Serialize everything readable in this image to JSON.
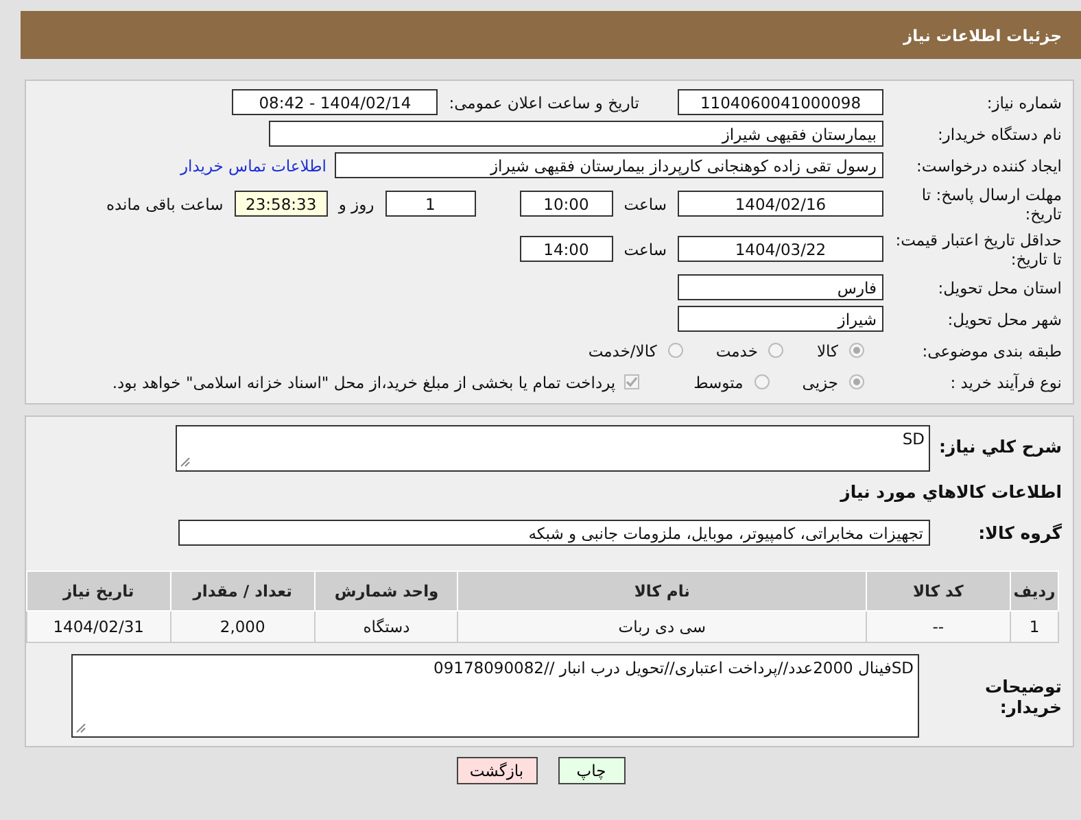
{
  "header": {
    "title": "جزئیات اطلاعات نیاز"
  },
  "details": {
    "need_number": {
      "label": "شماره نیاز:",
      "value": "1104060041000098"
    },
    "announce": {
      "label": "تاریخ و ساعت اعلان عمومی:",
      "value": "1404/02/14 - 08:42"
    },
    "buyer_org": {
      "label": "نام دستگاه خریدار:",
      "value": "بیمارستان فقیهی شیراز"
    },
    "requester": {
      "label": "ایجاد کننده درخواست:",
      "value": "رسول تقی زاده کوهنجانی کارپرداز بیمارستان فقیهی شیراز",
      "link": "اطلاعات تماس خریدار"
    },
    "deadline": {
      "label": "مهلت ارسال پاسخ: تا تاریخ:",
      "date": "1404/02/16",
      "time_label": "ساعت",
      "time": "10:00",
      "days": "1",
      "days_label": "روز و",
      "remaining": "23:58:33",
      "remaining_label": "ساعت باقی مانده"
    },
    "validity": {
      "label": "حداقل تاریخ اعتبار قیمت: تا تاریخ:",
      "date": "1404/03/22",
      "time_label": "ساعت",
      "time": "14:00"
    },
    "province": {
      "label": "استان محل تحویل:",
      "value": "فارس"
    },
    "city": {
      "label": "شهر محل تحویل:",
      "value": "شیراز"
    },
    "category": {
      "label": "طبقه بندی موضوعی:",
      "options": [
        {
          "label": "کالا",
          "selected": true
        },
        {
          "label": "خدمت",
          "selected": false
        },
        {
          "label": "کالا/خدمت",
          "selected": false
        }
      ]
    },
    "process": {
      "label": "نوع فرآیند خرید :",
      "options": [
        {
          "label": "جزیی",
          "selected": true
        },
        {
          "label": "متوسط",
          "selected": false
        }
      ],
      "payment": {
        "label": "پرداخت تمام یا بخشی از مبلغ خرید،از محل \"اسناد خزانه اسلامی\" خواهد بود.",
        "checked": true
      }
    }
  },
  "description": {
    "label": "شرح كلي نیاز:",
    "value": "SD"
  },
  "goods": {
    "title": "اطلاعات كالاهاي مورد نیاز",
    "group": {
      "label": "گروه کالا:",
      "value": "تجهیزات مخابراتی، کامپیوتر، موبایل، ملزومات جانبی و شبکه"
    },
    "columns": [
      "ردیف",
      "کد کالا",
      "نام کالا",
      "واحد شمارش",
      "تعداد / مقدار",
      "تاریخ نیاز"
    ],
    "rows": [
      [
        "1",
        "--",
        "سی دی ربات",
        "دستگاه",
        "2,000",
        "1404/02/31"
      ]
    ]
  },
  "buyer_notes": {
    "label": "توضیحات خریدار:",
    "value": "SDفینال 2000عدد//پرداخت اعتباری//تحویل درب انبار //09178090082"
  },
  "buttons": [
    {
      "label": "چاپ",
      "kind": "print"
    },
    {
      "label": "بازگشت",
      "kind": "back"
    }
  ]
}
